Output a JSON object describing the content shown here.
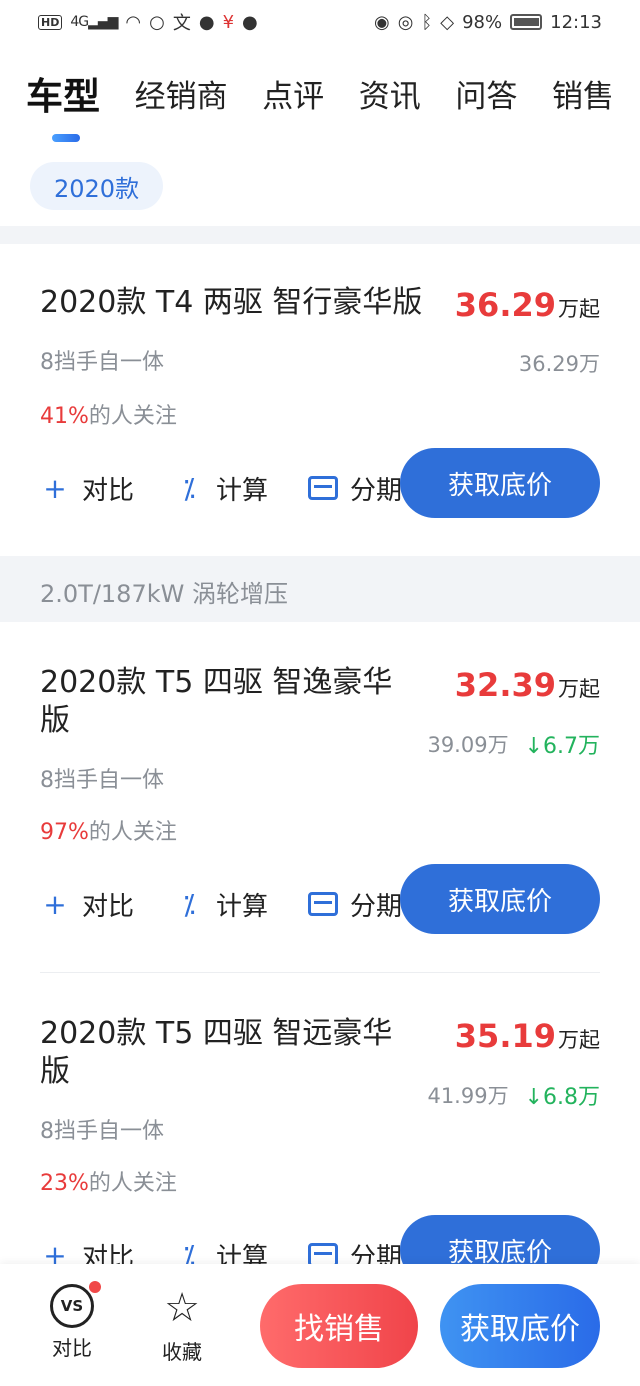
{
  "status_bar": {
    "left_badge": "HD",
    "network": "4G",
    "battery": "98%",
    "time": "12:13"
  },
  "tabs": [
    {
      "label": "车型",
      "active": true
    },
    {
      "label": "经销商"
    },
    {
      "label": "点评"
    },
    {
      "label": "资讯"
    },
    {
      "label": "问答"
    },
    {
      "label": "销售"
    }
  ],
  "year_chip": "2020款",
  "engine_group": "2.0T/187kW 涡轮增压",
  "actions": {
    "compare": "对比",
    "calc": "计算",
    "installment": "分期"
  },
  "cars": [
    {
      "name": "2020款 T4 两驱 智行豪华版",
      "price": "36.29",
      "price_suffix": "万起",
      "guide_price": "36.29万",
      "drop": "",
      "spec": "8挡手自一体",
      "attention_pct": "41%",
      "attention_text": "的人关注",
      "button": "获取底价"
    },
    {
      "name": "2020款 T5 四驱 智逸豪华版",
      "price": "32.39",
      "price_suffix": "万起",
      "guide_price": "39.09万",
      "drop": "↓6.7万",
      "spec": "8挡手自一体",
      "attention_pct": "97%",
      "attention_text": "的人关注",
      "button": "获取底价"
    },
    {
      "name": "2020款 T5 四驱 智远豪华版",
      "price": "35.19",
      "price_suffix": "万起",
      "guide_price": "41.99万",
      "drop": "↓6.8万",
      "spec": "8挡手自一体",
      "attention_pct": "23%",
      "attention_text": "的人关注",
      "button": "获取底价"
    }
  ],
  "bottom_bar": {
    "compare_label": "对比",
    "compare_icon_text": "VS",
    "favorite_label": "收藏",
    "find_sales": "找销售",
    "get_price": "获取底价"
  },
  "colors": {
    "accent": "#2f6fd9",
    "price_red": "#e83b3b",
    "drop_green": "#23b35d"
  }
}
